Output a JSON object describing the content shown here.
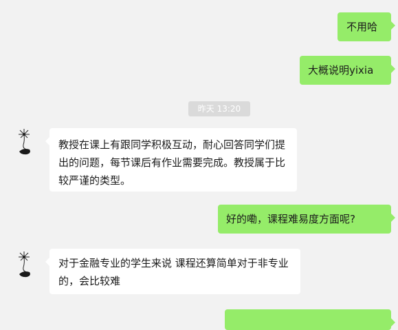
{
  "messages": [
    {
      "direction": "outgoing",
      "text": "不用哈"
    },
    {
      "direction": "outgoing",
      "text": "大概说明yixia"
    },
    {
      "direction": "incoming",
      "text": "教授在课上有跟同学积极互动，耐心回答同学们提出的问题，每节课后有作业需要完成。教授属于比较严谨的类型。"
    },
    {
      "direction": "outgoing",
      "text": "好的嘞，课程难易度方面呢?"
    },
    {
      "direction": "incoming",
      "text": "对于金融专业的学生来说 课程还算简单对于非专业的，会比较难"
    }
  ],
  "timestamp": "昨天 13:20",
  "avatar_icon": "dandelion-sketch-icon",
  "colors": {
    "background": "#f2f2f2",
    "outgoing_bubble": "#95ec69",
    "incoming_bubble": "#ffffff",
    "timestamp_bg": "#dadada"
  }
}
